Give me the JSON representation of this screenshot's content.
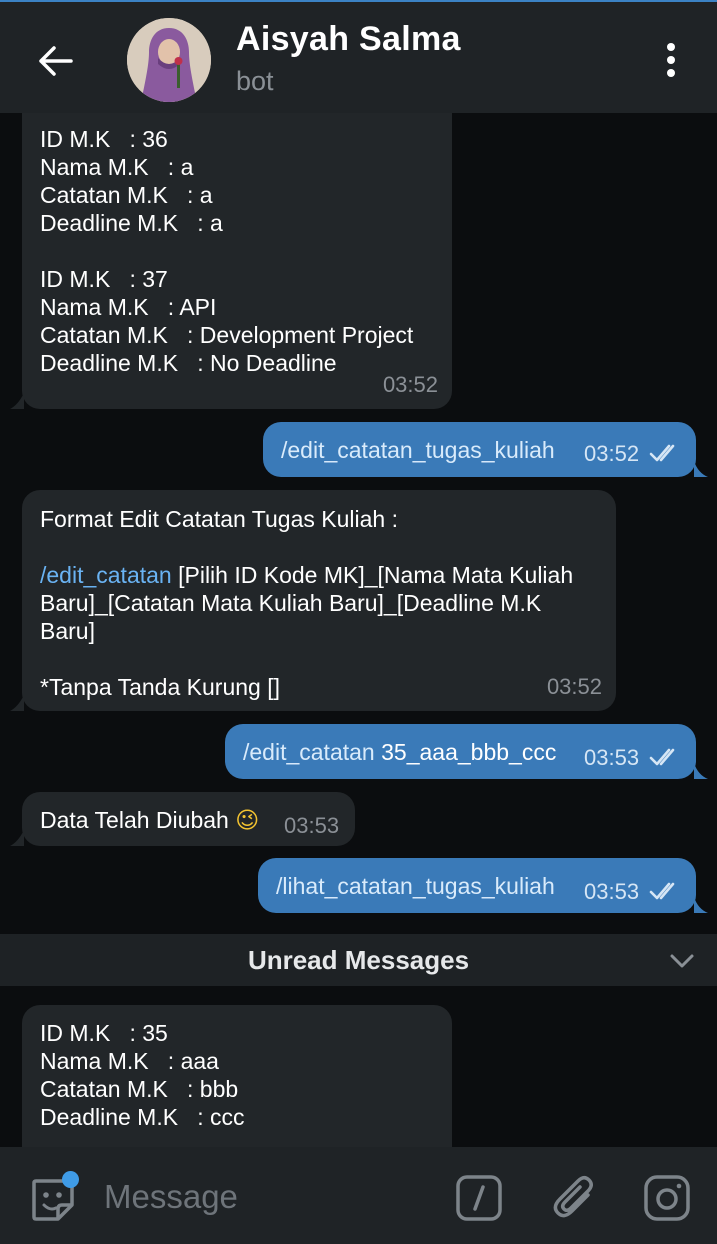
{
  "header": {
    "title": "Aisyah Salma",
    "subtitle": "bot"
  },
  "messages": {
    "m1": {
      "lines": [
        "ID M.K   : 36",
        "Nama M.K   : a",
        "Catatan M.K   : a",
        "Deadline M.K   : a",
        "",
        "ID M.K   : 37",
        "Nama M.K   : API",
        "Catatan M.K   : Development Project",
        "Deadline M.K   : No Deadline"
      ],
      "time": "03:52"
    },
    "m2": {
      "text": "/edit_catatan_tugas_kuliah",
      "time": "03:52"
    },
    "m3": {
      "line1": "Format Edit Catatan Tugas Kuliah :",
      "command": "/edit_catatan",
      "line2_rest": " [Pilih ID Kode MK]_[Nama Mata Kuliah",
      "line3": "Baru]_[Catatan Mata Kuliah Baru]_[Deadline M.K",
      "line4": "Baru]",
      "line5": "*Tanpa Tanda Kurung []",
      "time": "03:52"
    },
    "m4": {
      "command": "/edit_catatan",
      "rest": " 35_aaa_bbb_ccc",
      "time": "03:53"
    },
    "m5": {
      "text": "Data Telah Diubah",
      "emoji": "😉",
      "time": "03:53"
    },
    "m6": {
      "text": "/lihat_catatan_tugas_kuliah",
      "time": "03:53"
    },
    "m7": {
      "lines": [
        "ID M.K   : 35",
        "Nama M.K   : aaa",
        "Catatan M.K   : bbb",
        "Deadline M.K   : ccc"
      ]
    }
  },
  "unread": {
    "label": "Unread Messages"
  },
  "input": {
    "placeholder": "Message"
  },
  "colors": {
    "header_bg": "#1f2326",
    "incoming_bubble": "#222629",
    "outgoing_bubble": "#3a7ab8",
    "link": "#6ab3f3",
    "accent": "#3f9be6"
  },
  "icons": {
    "back": "arrow-left-icon",
    "menu": "more-vertical-icon",
    "sticker": "sticker-icon",
    "command": "bot-command-icon",
    "attach": "paperclip-icon",
    "camera": "camera-icon",
    "read_ticks": "double-check-icon",
    "collapse": "chevron-down-icon"
  }
}
